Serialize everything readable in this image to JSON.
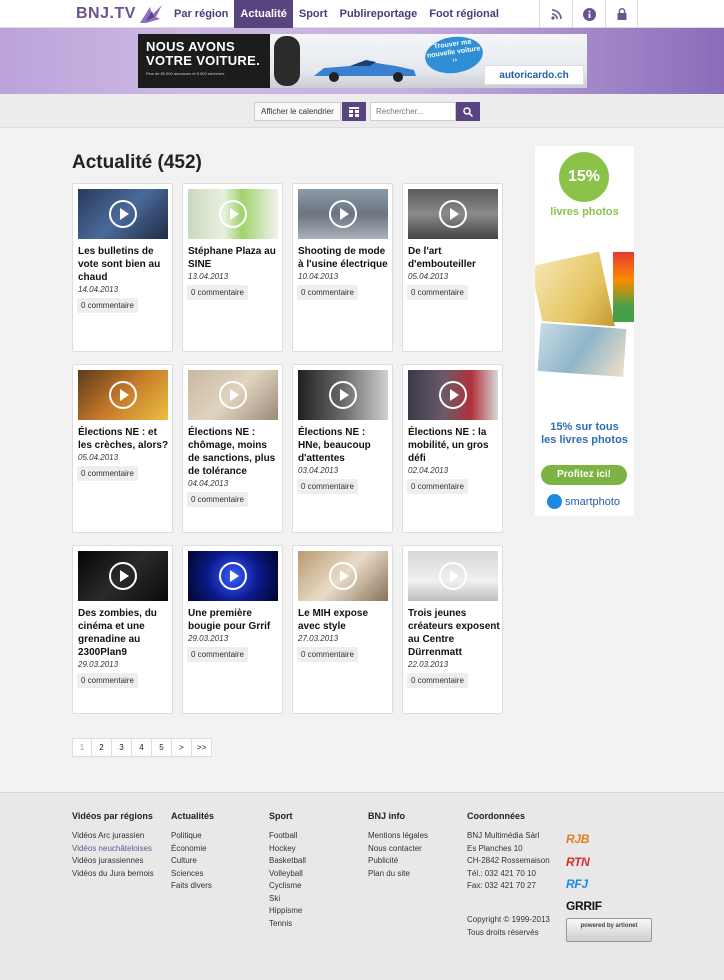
{
  "header": {
    "logo": "BNJ.TV",
    "menu": [
      {
        "label": "Par région",
        "active": false
      },
      {
        "label": "Actualité",
        "active": true
      },
      {
        "label": "Sport",
        "active": false
      },
      {
        "label": "Publireportage",
        "active": false
      },
      {
        "label": "Foot régional",
        "active": false
      }
    ],
    "icons": [
      "rss-icon",
      "info-icon",
      "lock-icon"
    ]
  },
  "banner_ad": {
    "headline_1": "NOUS AVONS",
    "headline_2": "VOTRE VOITURE.",
    "subline": "Plus de 85 000 annonces et 5 000 enchères.",
    "bubble": "Trouver ma nouvelle voiture ››",
    "brand": "autoricardo.ch"
  },
  "toolbar": {
    "calendar_label": "Afficher le calendrier",
    "search_placeholder": "Rechercher..."
  },
  "main": {
    "title": "Actualité (452)",
    "videos": [
      {
        "title": "Les bulletins de vote sont bien au chaud",
        "date": "14.04.2013",
        "comments": "0 commentaire"
      },
      {
        "title": "Stéphane Plaza au SINE",
        "date": "13.04.2013",
        "comments": "0 commentaire"
      },
      {
        "title": "Shooting de mode à l'usine électrique",
        "date": "10.04.2013",
        "comments": "0 commentaire"
      },
      {
        "title": "De l'art d'embouteiller",
        "date": "05.04.2013",
        "comments": "0 commentaire"
      },
      {
        "title": "Élections NE : et les crèches, alors?",
        "date": "05.04.2013",
        "comments": "0 commentaire"
      },
      {
        "title": "Élections NE : chômage, moins de sanctions, plus de tolérance",
        "date": "04.04.2013",
        "comments": "0 commentaire"
      },
      {
        "title": "Élections NE : HNe, beaucoup d'attentes",
        "date": "03.04.2013",
        "comments": "0 commentaire"
      },
      {
        "title": "Élections NE : la mobilité, un gros défi",
        "date": "02.04.2013",
        "comments": "0 commentaire"
      },
      {
        "title": "Des zombies, du cinéma et une grenadine au 2300Plan9",
        "date": "29.03.2013",
        "comments": "0 commentaire"
      },
      {
        "title": "Une première bougie pour Grrif",
        "date": "29.03.2013",
        "comments": "0 commentaire"
      },
      {
        "title": "Le MIH expose avec style",
        "date": "27.03.2013",
        "comments": "0 commentaire"
      },
      {
        "title": "Trois jeunes créateurs exposent au Centre Dürrenmatt",
        "date": "22.03.2013",
        "comments": "0 commentaire"
      }
    ]
  },
  "side_ad": {
    "percent": "15%",
    "subtitle": "livres photos",
    "text_1": "15% sur tous",
    "text_2": "les livres photos",
    "button": "Profitez ici!",
    "brand": "smartphoto"
  },
  "pagination": [
    "1",
    "2",
    "3",
    "4",
    "5",
    ">",
    ">>"
  ],
  "footer": {
    "columns": [
      {
        "heading": "Vidéos par régions",
        "items": [
          "Vidéos Arc jurassien",
          "Vidéos neuchâteloises",
          "Vidéos jurassiennes",
          "Vidéos du Jura bernois"
        ]
      },
      {
        "heading": "Actualités",
        "items": [
          "Politique",
          "Économie",
          "Culture",
          "Sciences",
          "Faits divers"
        ]
      },
      {
        "heading": "Sport",
        "items": [
          "Football",
          "Hockey",
          "Basketball",
          "Volleyball",
          "Cyclisme",
          "Ski",
          "Hippisme",
          "Tennis"
        ]
      },
      {
        "heading": "BNJ info",
        "items": [
          "Mentions légales",
          "Nous contacter",
          "Publicité",
          "Plan du site"
        ]
      },
      {
        "heading": "Coordonnées",
        "items": [
          "BNJ Multimédia Sàrl",
          "Es Planches 10",
          "CH-2842 Rossemaison",
          "Tél.: 032 421 70 10",
          "Fax: 032 421 70 27"
        ]
      }
    ],
    "copyright_1": "Copyright © 1999-2013",
    "copyright_2": "Tous droits réservés",
    "stations": [
      "RJB",
      "RTN",
      "RFJ",
      "GRRIF"
    ],
    "powered": "powered by artionet"
  },
  "colors": {
    "brand_purple": "#58457f",
    "accent_green": "#8bc34a"
  }
}
